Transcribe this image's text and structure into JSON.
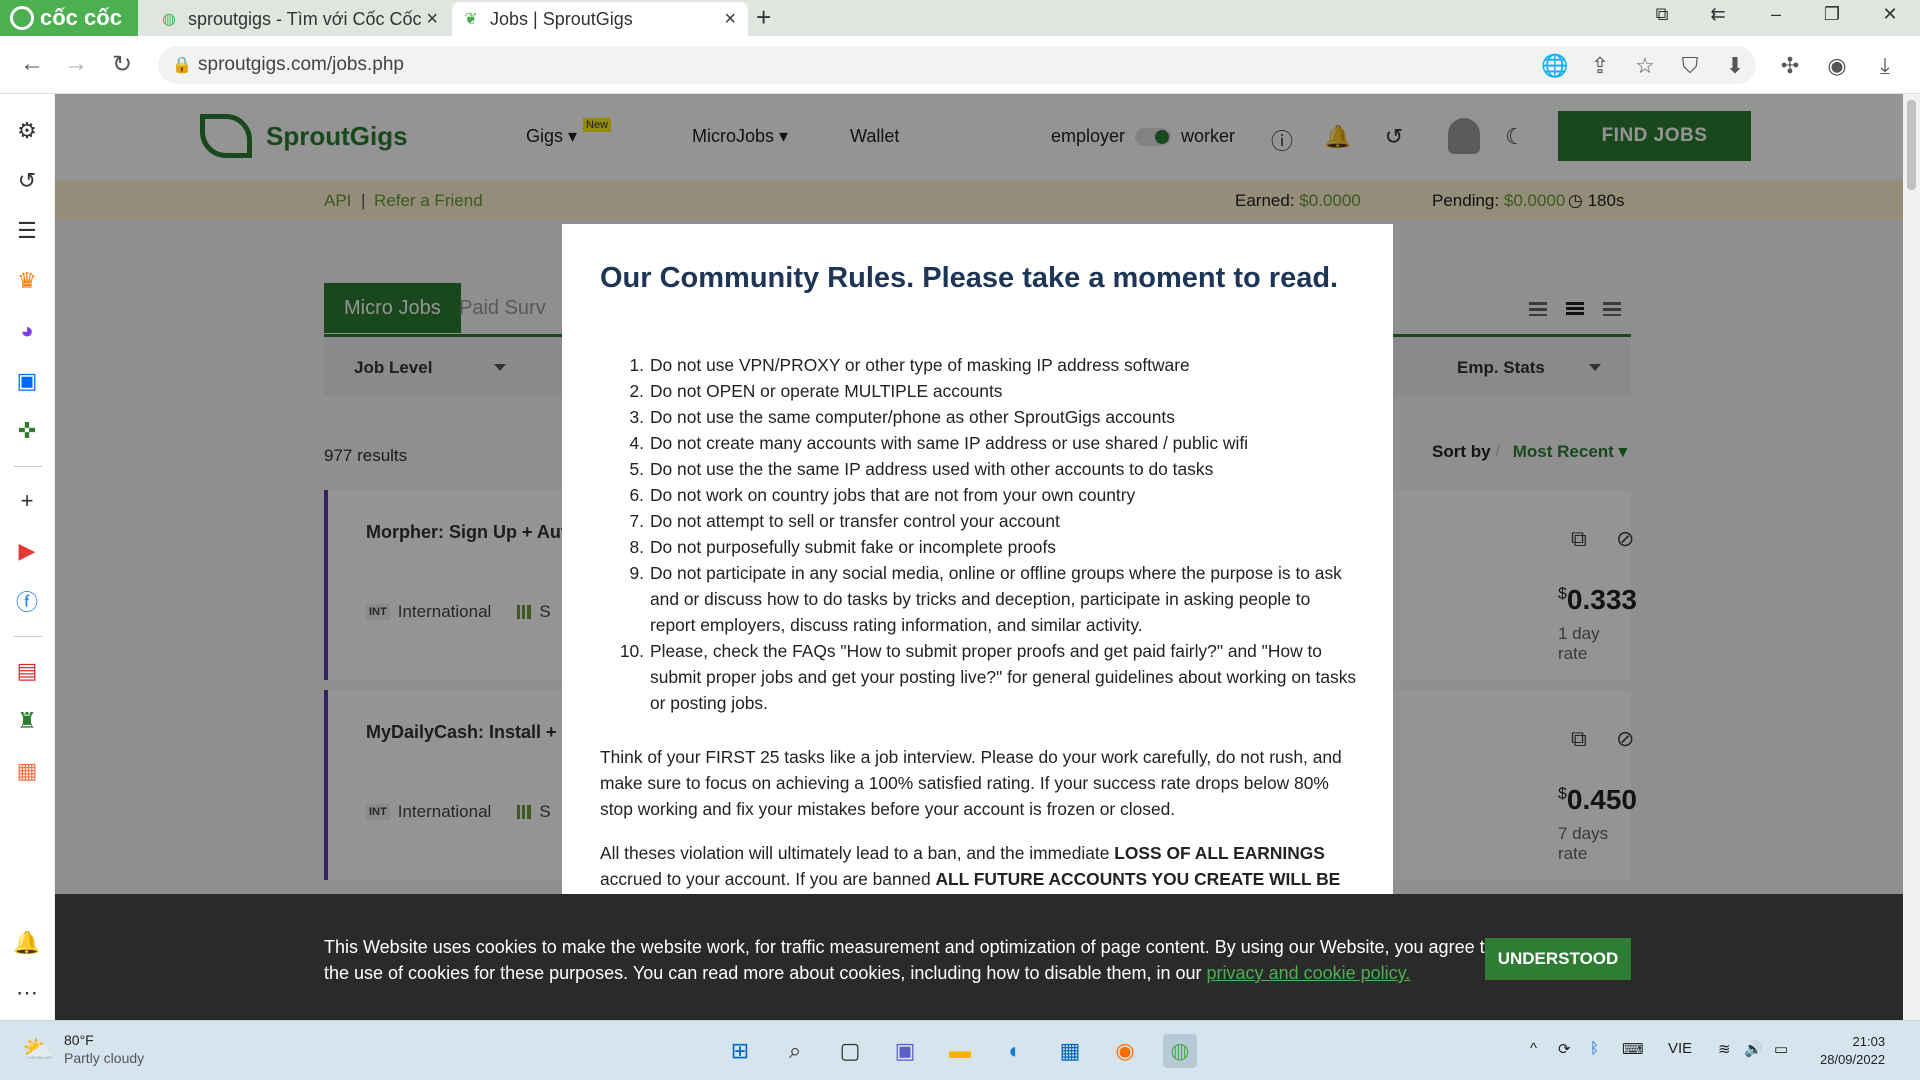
{
  "browser": {
    "brand": "cốc cốc",
    "tabs": [
      {
        "title": "sproutgigs - Tìm với Cốc Cốc"
      },
      {
        "title": "Jobs | SproutGigs"
      }
    ],
    "url": "sproutgigs.com/jobs.php"
  },
  "site": {
    "logo_text": "SproutGigs",
    "nav": {
      "gigs": "Gigs",
      "gigs_badge": "New",
      "microjobs": "MicroJobs",
      "wallet": "Wallet",
      "employer": "employer",
      "worker": "worker"
    },
    "find_jobs": "FIND JOBS",
    "subbar": {
      "api": "API",
      "separator": "|",
      "refer": "Refer a Friend",
      "earned_label": "Earned:",
      "earned_value": "$0.0000",
      "pending_label": "Pending:",
      "pending_value": "$0.0000",
      "timer": "180s"
    },
    "tabs": {
      "micro_jobs": "Micro Jobs",
      "paid_surveys": "Paid Surv"
    },
    "filters": {
      "job_level": "Job Level",
      "emp_stats": "Emp. Stats"
    },
    "results": "977 results",
    "sort": {
      "label": "Sort by",
      "separator": "/",
      "value": "Most Recent"
    },
    "jobs": [
      {
        "title": "Morpher: Sign Up + Aut",
        "region_badge": "INT",
        "region": "International",
        "meta": "S",
        "currency": "$",
        "price": "0.333",
        "rate": "1 day rate"
      },
      {
        "title": "MyDailyCash: Install + ",
        "region_badge": "INT",
        "region": "International",
        "meta": "S",
        "currency": "$",
        "price": "0.450",
        "rate": "7 days rate"
      }
    ]
  },
  "modal": {
    "title": "Our Community Rules. Please take a moment to read.",
    "rules": [
      "Do not use VPN/PROXY or other type of masking IP address software",
      "Do not OPEN or operate MULTIPLE accounts",
      "Do not use the same computer/phone as other SproutGigs accounts",
      "Do not create many accounts with same IP address or use shared / public wifi",
      "Do not use the the same IP address used with other accounts to do tasks",
      "Do not work on country jobs that are not from your own country",
      "Do not attempt to sell or transfer control your account",
      "Do not purposefully submit fake or incomplete proofs",
      "Do not participate in any social media, online or offline groups where the purpose is to ask and or discuss how to do tasks by tricks and deception, participate in asking people to report employers, discuss rating information, and similar activity.",
      "Please, check the FAQs \"How to submit proper proofs and get paid fairly?\" and \"How to submit proper jobs and get your posting live?\" for general guidelines about working on tasks or posting jobs."
    ],
    "para1": "Think of your FIRST 25 tasks like a job interview. Please do your work carefully, do not rush, and make sure to focus on achieving a 100% satisfied rating. If your success rate drops below 80% stop working and fix your mistakes before your account is frozen or closed.",
    "para2_start": "All theses violation will ultimately lead to a ban, and the immediate ",
    "para2_bold1": "LOSS OF ALL EARNINGS",
    "para2_mid": " accrued to your account. If you are banned ",
    "para2_bold2": "ALL FUTURE ACCOUNTS YOU CREATE WILL BE"
  },
  "cookie": {
    "text": "This Website uses cookies to make the website work, for traffic measurement and optimization of page content. By using our Website, you agree to the use of cookies for these purposes. You can read more about cookies, including how to disable them, in our ",
    "link": "privacy and cookie policy.",
    "button": "UNDERSTOOD"
  },
  "taskbar": {
    "temp": "80°F",
    "condition": "Partly cloudy",
    "lang": "VIE",
    "time": "21:03",
    "date": "28/09/2022"
  }
}
